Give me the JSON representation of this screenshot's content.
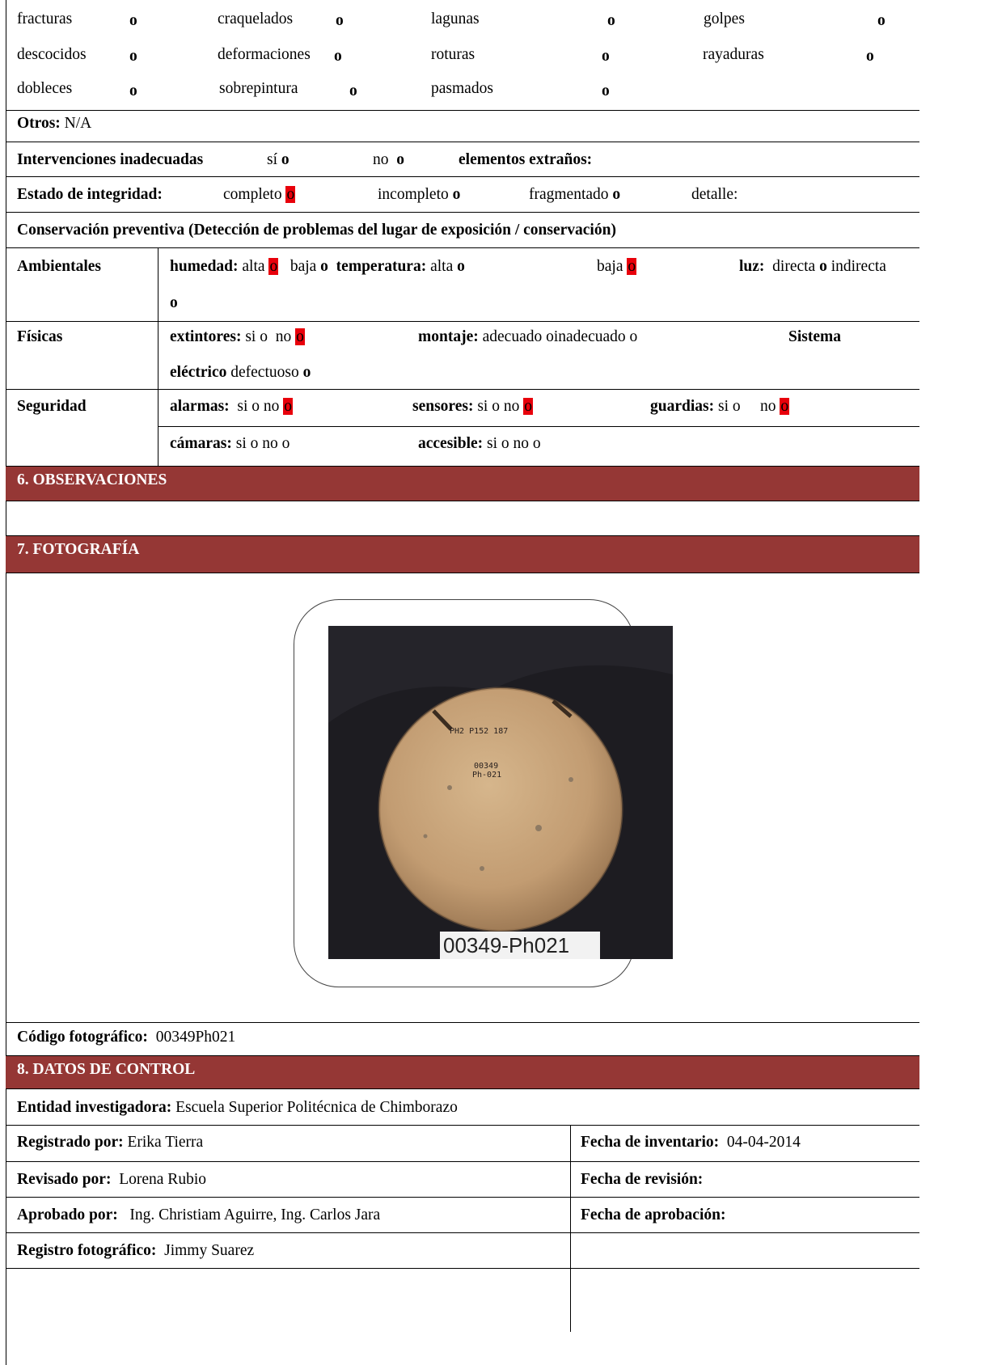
{
  "damage": {
    "row1": [
      "fracturas",
      "craquelados",
      "lagunas",
      "golpes"
    ],
    "row2": [
      "descocidos",
      "deformaciones",
      "roturas",
      "rayaduras"
    ],
    "row3": [
      "dobleces",
      "sobrepintura",
      "pasmados"
    ],
    "mark": "o"
  },
  "otros": {
    "label": "Otros:",
    "value": "N/A"
  },
  "intervenciones": {
    "label": "Intervenciones inadecuadas",
    "si": "sí",
    "no": "no",
    "extranos": "elementos extraños:"
  },
  "integridad": {
    "label": "Estado de integridad:",
    "completo": "completo",
    "incompleto": "incompleto",
    "fragmentado": "fragmentado",
    "detalle": "detalle:"
  },
  "conservacion": {
    "title": "Conservación preventiva (Detección de problemas del lugar de exposición / conservación)"
  },
  "ambientales": {
    "label": "Ambientales",
    "humedad": "humedad:",
    "alta": "alta",
    "baja": "baja",
    "temperatura": "temperatura:",
    "luz": "luz:",
    "directa": "directa",
    "indirecta": "indirecta"
  },
  "fisicas": {
    "label": "Físicas",
    "extintores": "extintores:",
    "si": "si",
    "no": "no",
    "montaje": "montaje:",
    "montaje_text": "adecuado oinadecuado o",
    "sistema": "Sistema",
    "electrico": "eléctrico",
    "defectuoso": "defectuoso"
  },
  "seguridad": {
    "label": "Seguridad",
    "alarmas": "alarmas:",
    "alarmas_opts": "si o no",
    "sensores": "sensores:",
    "sensores_opts": "si o  no",
    "guardias": "guardias:",
    "guardias_si": "si  o",
    "guardias_no": "no",
    "camaras": "cámaras:",
    "camaras_opts": "si o no  o",
    "accesible": "accesible:",
    "accesible_opts": "si  o  no o"
  },
  "sections": {
    "observaciones": "6. OBSERVACIONES",
    "fotografia": "7. FOTOGRAFÍA",
    "control": "8. DATOS DE CONTROL"
  },
  "photo": {
    "tag": "00349-Ph021",
    "ink1": "PH2 P152 187",
    "ink2": "00349",
    "ink3": "Ph-021"
  },
  "codigo": {
    "label": "Código fotográfico:",
    "value": "00349Ph021"
  },
  "control": {
    "entidad_label": "Entidad investigadora:",
    "entidad": "Escuela Superior Politécnica de Chimborazo",
    "registrado_label": "Registrado por:",
    "registrado": "Erika Tierra",
    "fecha_inv_label": "Fecha de inventario:",
    "fecha_inv": "04-04-2014",
    "revisado_label": "Revisado por:",
    "revisado": "Lorena Rubio",
    "fecha_rev_label": "Fecha de revisión:",
    "aprobado_label": "Aprobado por:",
    "aprobado": "Ing. Christiam Aguirre, Ing. Carlos Jara",
    "fecha_apr_label": "Fecha de aprobación:",
    "foto_label": "Registro fotográfico:",
    "foto": "Jimmy Suarez"
  },
  "colors": {
    "band": "#953735",
    "mark_highlight": "#e8000b"
  }
}
